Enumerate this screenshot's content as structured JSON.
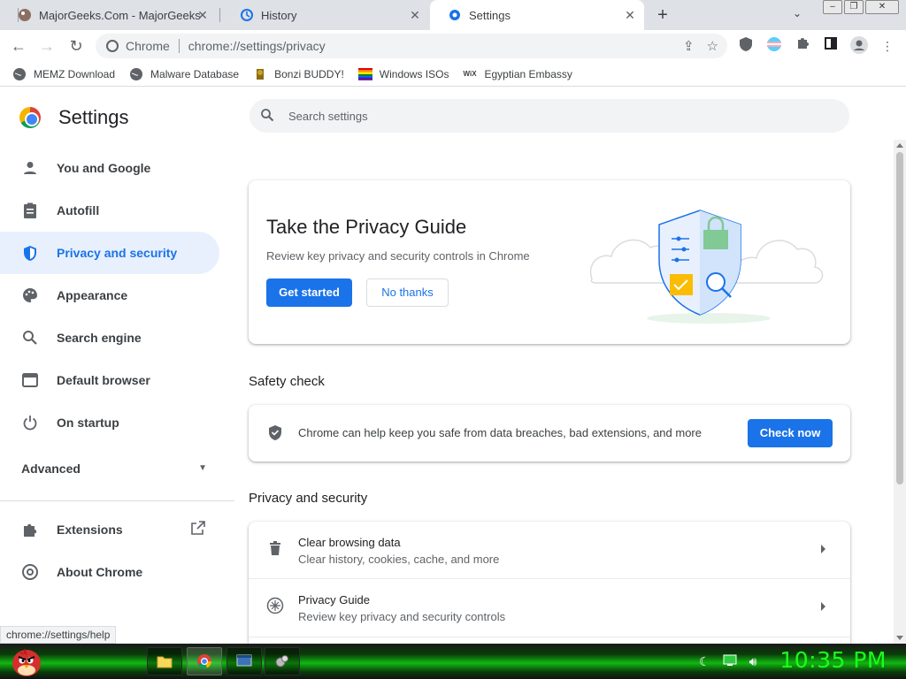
{
  "tabs": [
    {
      "title": "MajorGeeks.Com - MajorGeeks",
      "icon": "majorgeeks-icon"
    },
    {
      "title": "History",
      "icon": "history-icon"
    },
    {
      "title": "Settings",
      "icon": "gear-icon",
      "active": true
    }
  ],
  "toolbar": {
    "site_label": "Chrome",
    "url": "chrome://settings/privacy"
  },
  "bookmarks": [
    {
      "label": "MEMZ Download",
      "icon": "globe-icon"
    },
    {
      "label": "Malware Database",
      "icon": "globe-icon"
    },
    {
      "label": "Bonzi BUDDY!",
      "icon": "bonzi-icon"
    },
    {
      "label": "Windows ISOs",
      "icon": "windows-flag-icon"
    },
    {
      "label": "Egyptian Embassy",
      "icon": "wix-icon"
    }
  ],
  "sidebar": {
    "title": "Settings",
    "items": [
      {
        "label": "You and Google",
        "icon": "person-icon"
      },
      {
        "label": "Autofill",
        "icon": "clipboard-icon"
      },
      {
        "label": "Privacy and security",
        "icon": "shield-icon",
        "active": true
      },
      {
        "label": "Appearance",
        "icon": "palette-icon"
      },
      {
        "label": "Search engine",
        "icon": "search-icon"
      },
      {
        "label": "Default browser",
        "icon": "browser-icon"
      },
      {
        "label": "On startup",
        "icon": "power-icon"
      }
    ],
    "advanced_label": "Advanced",
    "extensions_label": "Extensions",
    "about_label": "About Chrome"
  },
  "search": {
    "placeholder": "Search settings"
  },
  "privacy_guide": {
    "title": "Take the Privacy Guide",
    "subtitle": "Review key privacy and security controls in Chrome",
    "primary_label": "Get started",
    "secondary_label": "No thanks"
  },
  "safety_check": {
    "heading": "Safety check",
    "text": "Chrome can help keep you safe from data breaches, bad extensions, and more",
    "button_label": "Check now"
  },
  "privacy_section": {
    "heading": "Privacy and security",
    "rows": [
      {
        "title": "Clear browsing data",
        "subtitle": "Clear history, cookies, cache, and more",
        "icon": "trash-icon"
      },
      {
        "title": "Privacy Guide",
        "subtitle": "Review key privacy and security controls",
        "icon": "compass-icon"
      }
    ]
  },
  "status_bar": {
    "url": "chrome://settings/help"
  },
  "taskbar": {
    "clock": "10:35 PM"
  },
  "colors": {
    "accent": "#1a73e8",
    "active_nav_bg": "#e8f0fe",
    "clock": "#1aff1a"
  }
}
